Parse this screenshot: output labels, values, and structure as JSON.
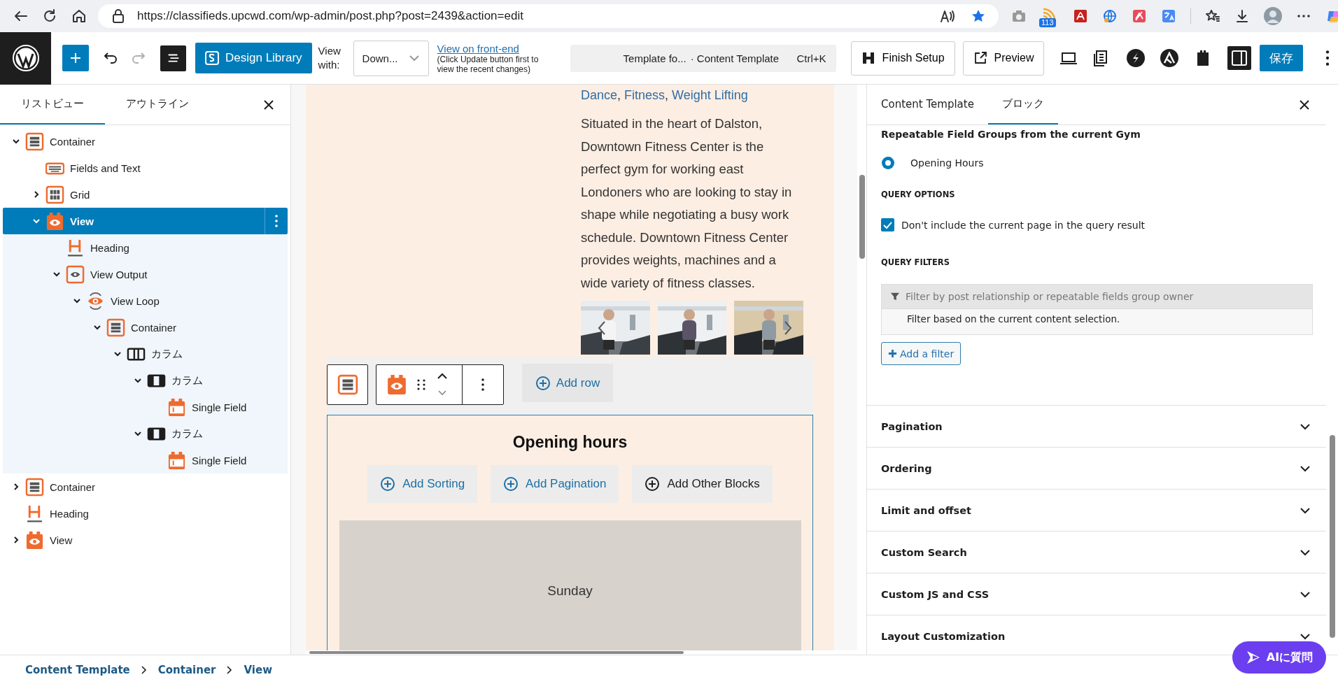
{
  "browser": {
    "url": "https://classifieds.upcwd.com/wp-admin/post.php?post=2439&action=edit",
    "feed_badge": "113"
  },
  "toolbar": {
    "redo_disabled": true,
    "design_library": "Design Library",
    "view_with_label": "View with:",
    "view_with_value": "Down...",
    "front_end_link": "View on front-end",
    "front_end_note": "(Click Update button first to view the recent changes)",
    "command_title": "Template fo...",
    "command_context": "· Content Template",
    "command_shortcut": "Ctrl+K",
    "finish_setup": "Finish Setup",
    "preview": "Preview",
    "settings_open": true,
    "save": "保存"
  },
  "list_view": {
    "tabs": [
      {
        "label": "リストビュー",
        "selected": true
      },
      {
        "label": "アウトライン",
        "selected": false
      }
    ],
    "items": [
      {
        "label": "Container",
        "kind": "container",
        "expanded": true,
        "selected": false,
        "children": [
          {
            "label": "Fields and Text",
            "kind": "fields",
            "selected": false
          },
          {
            "label": "Grid",
            "kind": "grid",
            "expanded": false,
            "selected": false
          },
          {
            "label": "View",
            "kind": "view",
            "expanded": true,
            "selected": true,
            "children": [
              {
                "label": "Heading",
                "kind": "heading",
                "selected": false
              },
              {
                "label": "View Output",
                "kind": "output",
                "expanded": true,
                "selected": false,
                "children": [
                  {
                    "label": "View Loop",
                    "kind": "loop",
                    "expanded": true,
                    "selected": false,
                    "children": [
                      {
                        "label": "Container",
                        "kind": "container",
                        "expanded": true,
                        "selected": false,
                        "children": [
                          {
                            "label": "カラム",
                            "kind": "columns",
                            "expanded": true,
                            "selected": false,
                            "children": [
                              {
                                "label": "カラム",
                                "kind": "column",
                                "expanded": true,
                                "selected": false,
                                "children": [
                                  {
                                    "label": "Single Field",
                                    "kind": "field",
                                    "selected": false
                                  }
                                ]
                              },
                              {
                                "label": "カラム",
                                "kind": "column",
                                "expanded": true,
                                "selected": false,
                                "children": [
                                  {
                                    "label": "Single Field",
                                    "kind": "field",
                                    "selected": false
                                  }
                                ]
                              }
                            ]
                          }
                        ]
                      }
                    ]
                  }
                ]
              }
            ]
          }
        ]
      },
      {
        "label": "Container",
        "kind": "container",
        "expanded": false,
        "selected": false
      },
      {
        "label": "Heading",
        "kind": "heading",
        "selected": false
      },
      {
        "label": "View",
        "kind": "view",
        "expanded": false,
        "selected": false
      }
    ]
  },
  "canvas": {
    "terms": [
      "Dance",
      "Fitness",
      "Weight Lifting"
    ],
    "term_separator": ", ",
    "description": "Situated in the heart of Dalston, Downtown Fitness Center is the perfect gym for working east Londoners who are looking to stay in shape while negotiating a busy work schedule. Downtown Fitness Center provides weights, machines and a wide variety of fitness classes.",
    "gallery": [
      {
        "kind": "picture"
      },
      {
        "kind": "picture"
      },
      {
        "kind": "picture"
      }
    ],
    "add_row": "Add row",
    "loop_heading": "Opening hours",
    "loop_buttons": [
      {
        "label": "Add Sorting",
        "kind": "primary"
      },
      {
        "label": "Add Pagination",
        "kind": "primary"
      },
      {
        "label": "Add Other Blocks",
        "kind": "neutral"
      }
    ],
    "first_item": "Sunday"
  },
  "settings": {
    "tabs": [
      {
        "label": "Content Template",
        "selected": false
      },
      {
        "label": "ブロック",
        "selected": true
      }
    ],
    "source_heading": "Repeatable Field Groups from the current Gym",
    "sources": [
      {
        "label": "Opening Hours",
        "selected": true
      }
    ],
    "query_options_heading": "QUERY OPTIONS",
    "query_options": [
      {
        "label": "Don't include the current page in the query result",
        "checked": true
      }
    ],
    "query_filters_heading": "QUERY FILTERS",
    "filter": {
      "title": "Filter by post relationship or repeatable fields group owner",
      "description": "Filter based on the current content selection."
    },
    "add_filter": "Add a filter",
    "panels": [
      {
        "title": "Pagination",
        "expanded": false
      },
      {
        "title": "Ordering",
        "expanded": false
      },
      {
        "title": "Limit and offset",
        "expanded": false
      },
      {
        "title": "Custom Search",
        "expanded": false
      },
      {
        "title": "Custom JS and CSS",
        "expanded": false
      },
      {
        "title": "Layout Customization",
        "expanded": false
      }
    ]
  },
  "breadcrumb": [
    "Content Template",
    "Container",
    "View"
  ],
  "ai_button": "AIに質問"
}
